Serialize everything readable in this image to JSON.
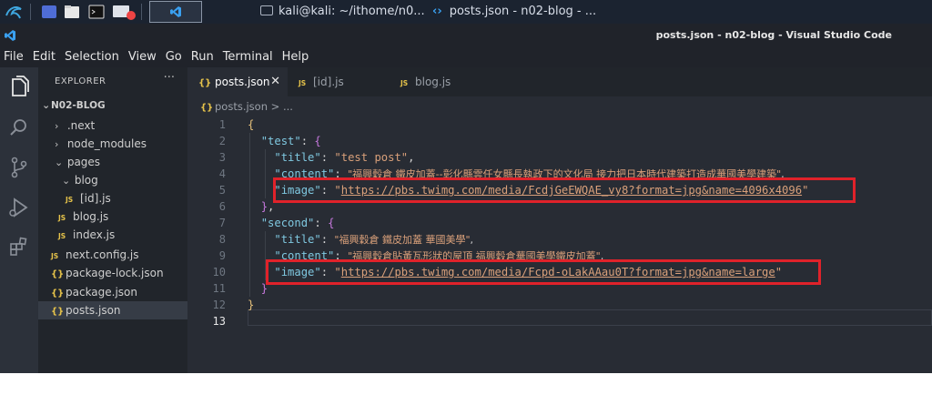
{
  "taskbar": {
    "terminal_task": "kali@kali: ~/ithome/n0...",
    "vscode_task": "posts.json - n02-blog - ..."
  },
  "window": {
    "title": "posts.json - n02-blog - Visual Studio Code"
  },
  "menu": [
    "File",
    "Edit",
    "Selection",
    "View",
    "Go",
    "Run",
    "Terminal",
    "Help"
  ],
  "sidebar": {
    "header": "EXPLORER",
    "more": "···",
    "project": "N02-BLOG",
    "tree": [
      {
        "label": ".next",
        "type": "folder-closed"
      },
      {
        "label": "node_modules",
        "type": "folder-closed"
      },
      {
        "label": "pages",
        "type": "folder-open"
      },
      {
        "label": "blog",
        "type": "folder-open"
      },
      {
        "label": "[id].js",
        "type": "js"
      },
      {
        "label": "blog.js",
        "type": "js"
      },
      {
        "label": "index.js",
        "type": "js"
      },
      {
        "label": "next.config.js",
        "type": "js"
      },
      {
        "label": "package-lock.json",
        "type": "json"
      },
      {
        "label": "package.json",
        "type": "json"
      },
      {
        "label": "posts.json",
        "type": "json"
      }
    ]
  },
  "tabs": [
    {
      "label": "posts.json",
      "icon": "{}",
      "active": true
    },
    {
      "label": "[id].js",
      "icon": "JS",
      "active": false
    },
    {
      "label": "blog.js",
      "icon": "JS",
      "active": false
    }
  ],
  "breadcrumb": "posts.json > ...",
  "editor": {
    "line_numbers": [
      "1",
      "2",
      "3",
      "4",
      "5",
      "6",
      "7",
      "8",
      "9",
      "10",
      "11",
      "12",
      "13"
    ],
    "current_line": "13",
    "keys": {
      "test": "\"test\"",
      "second": "\"second\"",
      "title": "\"title\"",
      "content": "\"content\"",
      "image": "\"image\""
    },
    "values": {
      "test_title": "\"test post\"",
      "test_content": "\"福興穀倉 鐵皮加蓋--彰化縣雲任女縣長執政下的文化局 接力把日本時代建築打造成華國美學建築\"",
      "test_image": "https://pbs.twimg.com/media/FcdjGeEWQAE_vy8?format=jpg&name=4096x4096",
      "second_title": "\"福興穀倉 鐵皮加蓋 華國美學\"",
      "second_content": "\"福興穀倉貼黃瓦形狀的屋頂 福興穀倉華國美學鐵皮加蓋\"",
      "second_image": "https://pbs.twimg.com/media/Fcpd-oLakAAau0T?format=jpg&name=large"
    }
  },
  "colors": {
    "highlight_box": "#e0222a",
    "json_key": "#7fc8e0",
    "json_string": "#d9a07a"
  }
}
